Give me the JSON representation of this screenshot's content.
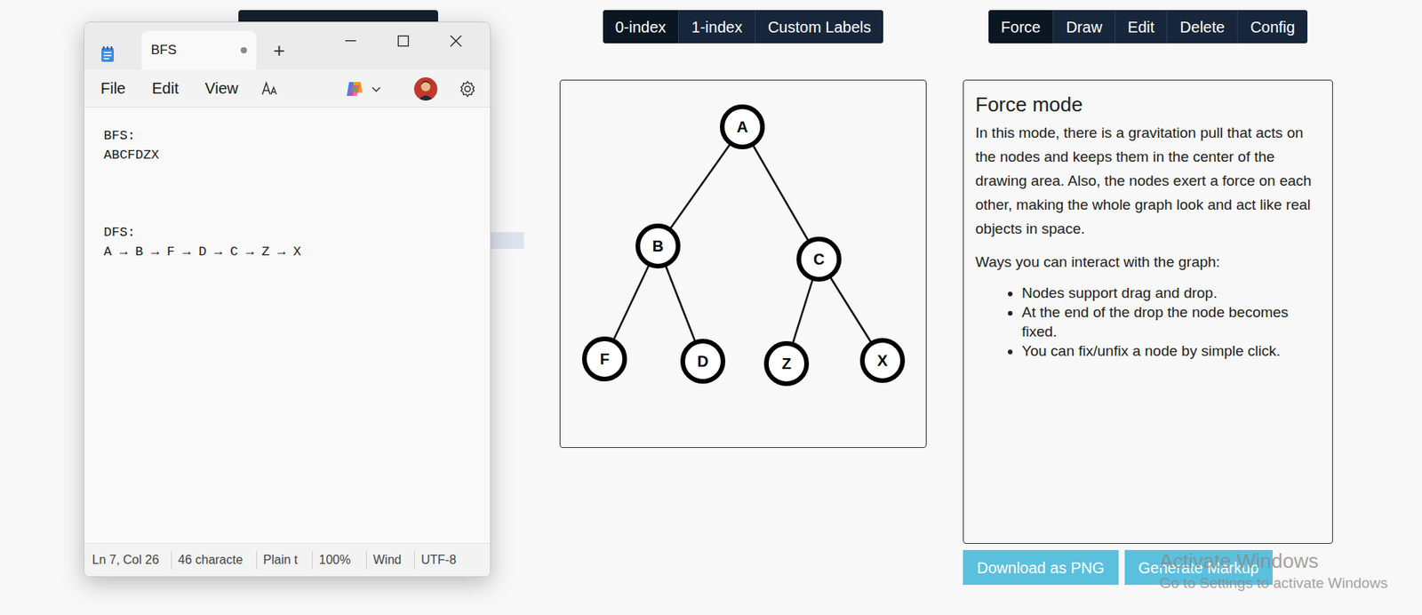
{
  "label_modes": [
    {
      "label": "0-index",
      "selected": true
    },
    {
      "label": "1-index",
      "selected": false
    },
    {
      "label": "Custom Labels",
      "selected": false
    }
  ],
  "modes": [
    {
      "label": "Force",
      "selected": true
    },
    {
      "label": "Draw",
      "selected": false
    },
    {
      "label": "Edit",
      "selected": false
    },
    {
      "label": "Delete",
      "selected": false
    },
    {
      "label": "Config",
      "selected": false
    }
  ],
  "graph": {
    "nodes": [
      "A",
      "B",
      "C",
      "F",
      "D",
      "Z",
      "X"
    ],
    "edges": [
      [
        "A",
        "B"
      ],
      [
        "A",
        "C"
      ],
      [
        "B",
        "F"
      ],
      [
        "B",
        "D"
      ],
      [
        "C",
        "Z"
      ],
      [
        "C",
        "X"
      ]
    ]
  },
  "info_panel": {
    "title": "Force mode",
    "paragraphs": [
      "In this mode, there is a gravitation pull that acts on the nodes and keeps them in the center of the drawing area. Also, the nodes exert a force on each other, making the whole graph look and act like real objects in space.",
      "Ways you can interact with the graph:"
    ],
    "bullets": [
      "Nodes support drag and drop.",
      "At the end of the drop the node becomes fixed.",
      "You can fix/unfix a node by simple click."
    ]
  },
  "buttons": [
    "Download as PNG",
    "Generate Markup"
  ],
  "watermark": {
    "title": "Activate Windows",
    "subtitle": "Go to Settings to activate Windows"
  },
  "notepad": {
    "tab": {
      "title": "BFS",
      "modified": true
    },
    "new_tab": "+",
    "menu": [
      "File",
      "Edit",
      "View"
    ],
    "lines": [
      "BFS:",
      "ABCFDZX",
      "",
      "",
      "",
      "DFS:",
      "A → B → F → D → C → Z → X"
    ],
    "status_bar": [
      "Ln 7, Col 26",
      "46 characte",
      "Plain t",
      "100%",
      "Wind",
      "UTF-8"
    ]
  }
}
